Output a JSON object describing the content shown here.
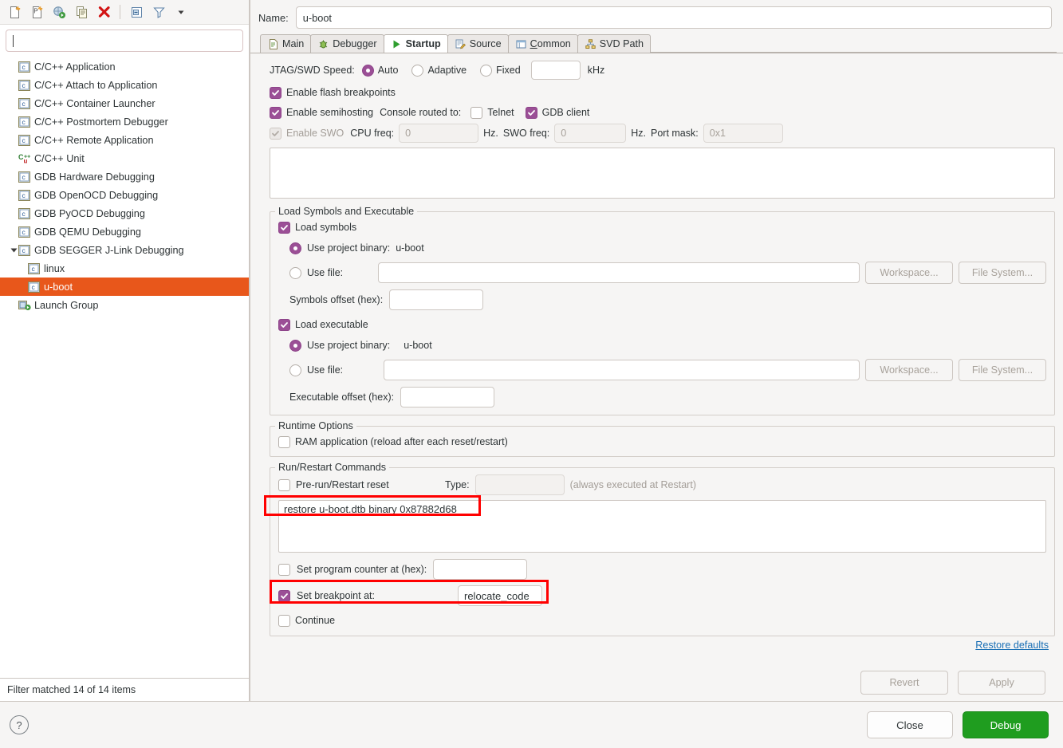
{
  "toolbar": {
    "buttons": [
      {
        "name": "new-launch-configuration",
        "icon": "new-config-icon"
      },
      {
        "name": "new-prototype",
        "icon": "new-prototype-icon"
      },
      {
        "name": "export",
        "icon": "export-icon"
      },
      {
        "name": "duplicate",
        "icon": "duplicate-icon"
      },
      {
        "name": "delete",
        "icon": "delete-icon"
      },
      {
        "name": "collapse-all",
        "icon": "collapse-all-icon"
      },
      {
        "name": "filter",
        "icon": "filter-icon"
      },
      {
        "name": "view-menu",
        "icon": "chevron-down-icon"
      }
    ]
  },
  "filter": {
    "value": "",
    "placeholder": ""
  },
  "tree": {
    "items": [
      {
        "label": "C/C++ Application",
        "icon": "c-launch-icon",
        "level": 0,
        "selected": false,
        "expander": "none"
      },
      {
        "label": "C/C++ Attach to Application",
        "icon": "c-launch-icon",
        "level": 0,
        "selected": false,
        "expander": "none"
      },
      {
        "label": "C/C++ Container Launcher",
        "icon": "c-launch-icon",
        "level": 0,
        "selected": false,
        "expander": "none"
      },
      {
        "label": "C/C++ Postmortem Debugger",
        "icon": "c-launch-icon",
        "level": 0,
        "selected": false,
        "expander": "none"
      },
      {
        "label": "C/C++ Remote Application",
        "icon": "c-launch-icon",
        "level": 0,
        "selected": false,
        "expander": "none"
      },
      {
        "label": "C/C++ Unit",
        "icon": "cpp-unit-icon",
        "level": 0,
        "selected": false,
        "expander": "none"
      },
      {
        "label": "GDB Hardware Debugging",
        "icon": "c-launch-icon",
        "level": 0,
        "selected": false,
        "expander": "none"
      },
      {
        "label": "GDB OpenOCD Debugging",
        "icon": "c-launch-icon",
        "level": 0,
        "selected": false,
        "expander": "none"
      },
      {
        "label": "GDB PyOCD Debugging",
        "icon": "c-launch-icon",
        "level": 0,
        "selected": false,
        "expander": "none"
      },
      {
        "label": "GDB QEMU Debugging",
        "icon": "c-launch-icon",
        "level": 0,
        "selected": false,
        "expander": "none"
      },
      {
        "label": "GDB SEGGER J-Link Debugging",
        "icon": "c-launch-icon",
        "level": 0,
        "selected": false,
        "expander": "expanded"
      },
      {
        "label": "linux",
        "icon": "c-launch-icon",
        "level": 1,
        "selected": false,
        "expander": "none"
      },
      {
        "label": "u-boot",
        "icon": "c-launch-icon",
        "level": 1,
        "selected": true,
        "expander": "none"
      },
      {
        "label": "Launch Group",
        "icon": "launch-group-icon",
        "level": 0,
        "selected": false,
        "expander": "none"
      }
    ],
    "status": "Filter matched 14 of 14 items"
  },
  "config": {
    "name_label": "Name:",
    "name_value": "u-boot",
    "tabs": [
      {
        "label": "Main",
        "icon": "main-tab-icon",
        "active": false,
        "mnemonic": ""
      },
      {
        "label": "Debugger",
        "icon": "debugger-tab-icon",
        "active": false,
        "mnemonic": ""
      },
      {
        "label": "Startup",
        "icon": "startup-tab-icon",
        "active": true,
        "mnemonic": ""
      },
      {
        "label": "Source",
        "icon": "source-tab-icon",
        "active": false,
        "mnemonic": ""
      },
      {
        "label": "Common",
        "icon": "common-tab-icon",
        "active": false,
        "mnemonic": "C"
      },
      {
        "label": "SVD Path",
        "icon": "svd-path-tab-icon",
        "active": false,
        "mnemonic": ""
      }
    ]
  },
  "startup": {
    "speed": {
      "label": "JTAG/SWD Speed:",
      "options": [
        {
          "label": "Auto",
          "selected": true
        },
        {
          "label": "Adaptive",
          "selected": false
        },
        {
          "label": "Fixed",
          "selected": false
        }
      ],
      "fixed_value": "",
      "unit": "kHz"
    },
    "flash_breakpoints": {
      "label": "Enable flash breakpoints",
      "checked": true
    },
    "semihosting": {
      "label": "Enable semihosting",
      "checked": true,
      "console_label": "Console routed to:",
      "telnet": {
        "label": "Telnet",
        "checked": false
      },
      "gdb_client": {
        "label": "GDB client",
        "checked": true
      }
    },
    "swo": {
      "label": "Enable SWO",
      "checked": true,
      "enabled": false,
      "cpu_freq_label": "CPU freq:",
      "cpu_freq_value": "0",
      "cpu_freq_unit": "Hz.",
      "swo_freq_label": "SWO freq:",
      "swo_freq_value": "0",
      "swo_freq_unit": "Hz.",
      "port_mask_label": "Port mask:",
      "port_mask_value": "0x1"
    },
    "init_commands": {
      "value": ""
    },
    "load_group": {
      "title": "Load Symbols and Executable",
      "load_symbols": {
        "label": "Load symbols",
        "checked": true
      },
      "symbols_project_binary": {
        "label": "Use project binary:",
        "value": "u-boot",
        "selected": true
      },
      "symbols_use_file": {
        "label": "Use file:",
        "value": "",
        "selected": false
      },
      "symbols_workspace_button": "Workspace...",
      "symbols_filesystem_button": "File System...",
      "symbols_offset": {
        "label": "Symbols offset (hex):",
        "value": ""
      },
      "load_executable": {
        "label": "Load executable",
        "checked": true
      },
      "exec_project_binary": {
        "label": "Use project binary:",
        "value": "u-boot",
        "selected": true
      },
      "exec_use_file": {
        "label": "Use file:",
        "value": "",
        "selected": false
      },
      "exec_workspace_button": "Workspace...",
      "exec_filesystem_button": "File System...",
      "exec_offset": {
        "label": "Executable offset (hex):",
        "value": ""
      }
    },
    "runtime_group": {
      "title": "Runtime Options",
      "ram_application": {
        "label": "RAM application (reload after each reset/restart)",
        "checked": false
      }
    },
    "run_group": {
      "title": "Run/Restart Commands",
      "prerun_reset": {
        "label": "Pre-run/Restart reset",
        "checked": false
      },
      "type_label": "Type:",
      "type_value": "",
      "type_hint": "(always executed at Restart)",
      "commands_value": "restore u-boot.dtb binary 0x87882d68",
      "set_pc": {
        "label": "Set program counter at (hex):",
        "value": "",
        "checked": false
      },
      "set_breakpoint": {
        "label": "Set breakpoint at:",
        "value": "relocate_code",
        "checked": true
      },
      "continue": {
        "label": "Continue",
        "checked": false
      }
    },
    "restore_defaults_link": "Restore defaults"
  },
  "footer": {
    "revert_button": "Revert",
    "apply_button": "Apply",
    "help_icon_label": "?",
    "close_button": "Close",
    "debug_button": "Debug"
  },
  "colors": {
    "selection": "#e8571b",
    "accent_check": "#9b4f96",
    "link": "#1a6fb5",
    "primary_button": "#1f9d1f",
    "annotation": "#ff0000"
  }
}
